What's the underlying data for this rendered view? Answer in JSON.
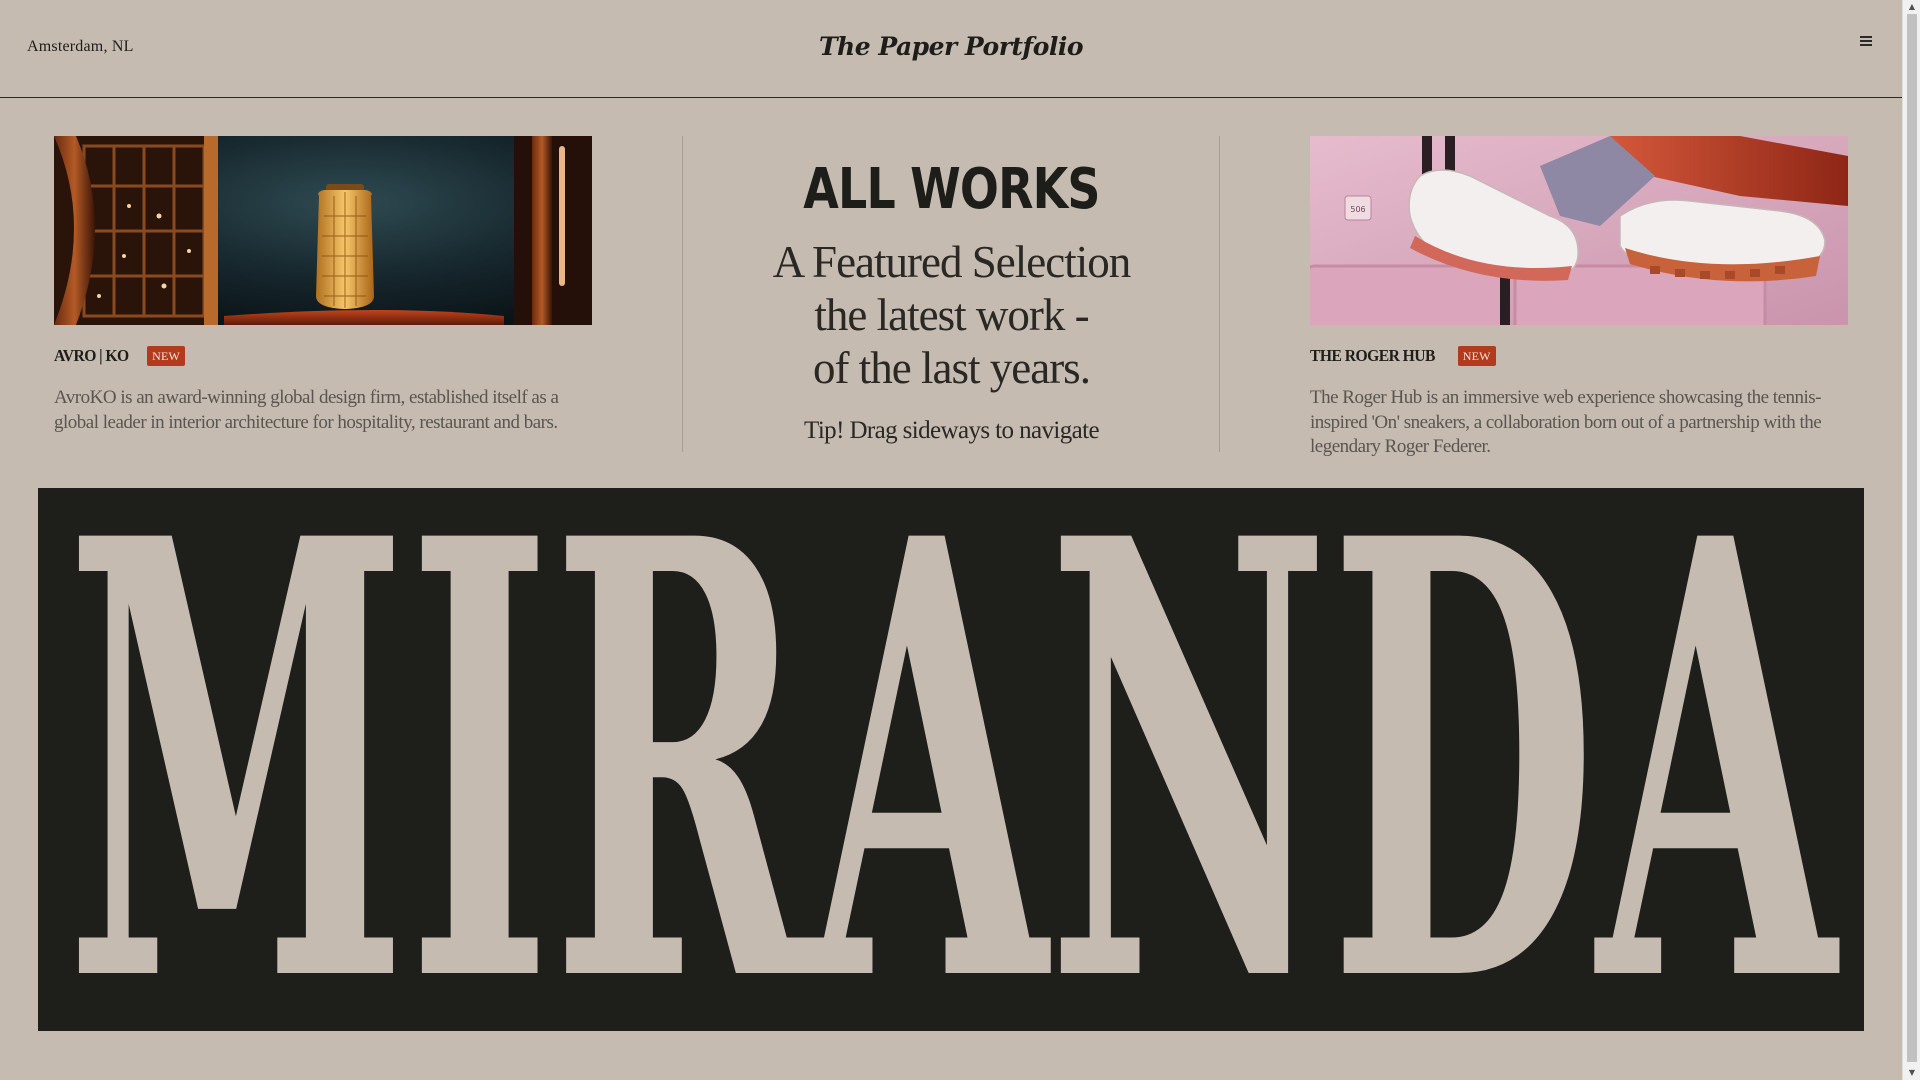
{
  "header": {
    "location": "Amsterdam, NL",
    "brand": "The Paper Portfolio",
    "menu_icon": "hamburger-menu-icon"
  },
  "projects": [
    {
      "title": "AVRO | KO",
      "badge": "NEW",
      "description": "AvroKO is an award-winning global design firm, established itself as a global leader in interior architecture for hospitality, restaurant and bars.",
      "image_alt": "lantern"
    },
    {
      "title": "THE ROGER HUB",
      "badge": "NEW",
      "description": "The Roger Hub is an immersive web experience showcasing the tennis-inspired 'On' sneakers, a collaboration born out of a partnership with the legendary Roger Federer.",
      "image_alt": "sneakers"
    }
  ],
  "intro": {
    "title": "ALL WORKS",
    "line1": "A Featured Selection",
    "line2": "the latest work -",
    "line3": "of the last years.",
    "tip": "Tip! Drag sideways to navigate"
  },
  "banner": {
    "word": "MIRANDA"
  },
  "colors": {
    "background": "#c5bbb1",
    "ink": "#1d1d1a",
    "badge": "#b33b1d",
    "banner_bg": "#1e1e1b",
    "banner_text": "#c5bbb1"
  }
}
